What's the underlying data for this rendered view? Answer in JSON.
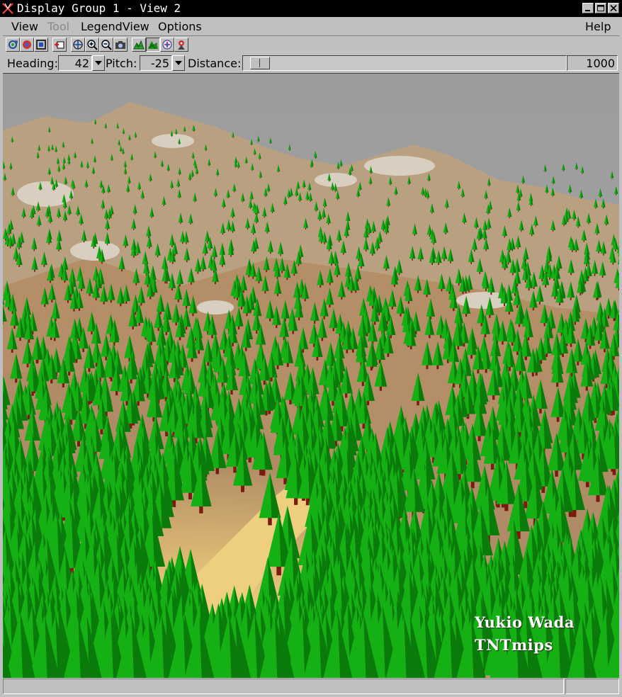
{
  "window": {
    "title": "Display Group 1 - View 2",
    "buttons": [
      "minimize-icon",
      "maximize-icon",
      "close-icon"
    ]
  },
  "menu": {
    "view": "View",
    "tool": "Tool",
    "legend_view": "LegendView",
    "options": "Options",
    "help": "Help"
  },
  "toolbar": {
    "icons": [
      "redraw-icon",
      "stop-icon",
      "full-view-icon",
      "layer-add-icon",
      "pan-icon",
      "zoom-in-icon",
      "zoom-out-icon",
      "snapshot-icon",
      "terrain-mesh-icon",
      "forest-render-icon",
      "scene-settings-icon",
      "viewer-position-icon"
    ],
    "pressed": "forest-render-icon"
  },
  "controls": {
    "heading_label": "Heading:",
    "heading_value": "42",
    "pitch_label": "Pitch:",
    "pitch_value": "-25",
    "distance_label": "Distance:",
    "distance_value": "1000",
    "distance_slider_level": 0.02
  },
  "scene": {
    "watermark_name": "Yukio Wada",
    "watermark_app": "TNTmips",
    "colors": {
      "sky": "#a2a2a2",
      "tree": "#14b014",
      "tree_dark": "#0a7a0a",
      "terrain": "#b89468",
      "terrain_light": "#e6c478",
      "trunk": "#7a1a10"
    }
  }
}
